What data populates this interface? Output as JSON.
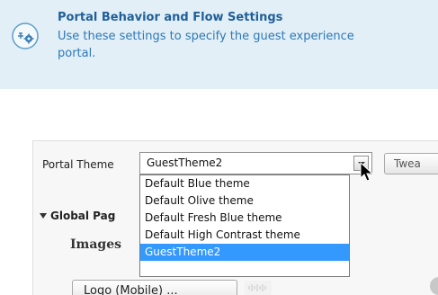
{
  "banner": {
    "title": "Portal Behavior and Flow Settings",
    "description": "Use these settings to specify the guest experience for this portal.",
    "description_line1": "Use these settings to specify the guest experience",
    "description_line2": "portal."
  },
  "portal_theme": {
    "label": "Portal Theme",
    "selected_value": "GuestTheme2",
    "options": [
      "Default Blue theme",
      "Default Olive theme",
      "Default Fresh Blue theme",
      "Default High Contrast theme",
      "GuestTheme2"
    ],
    "highlighted_index": 4
  },
  "tweaks_button": {
    "label": "Twea"
  },
  "global_section": {
    "title": "Global Pag"
  },
  "images": {
    "label": "Images",
    "logo_button_label": "Logo (Mobile) ..."
  },
  "colors": {
    "banner_bg": "#e2eff6",
    "title_color": "#1f5f9a",
    "desc_color": "#2e78b8",
    "highlight": "#3399ff"
  }
}
